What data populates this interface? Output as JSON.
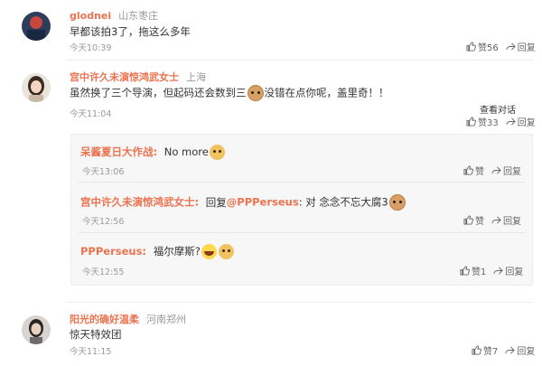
{
  "comments": [
    {
      "name": "glodnei",
      "location": "山东枣庄",
      "text": "早都该拍3了，拖这么多年",
      "time": "今天10:39",
      "like_label": "赞56",
      "reply_label": "回复"
    },
    {
      "name": "宫中许久未演惊鸿武女士",
      "location": "上海",
      "text_a": "虽然换了三个导演，但起码还会数到三",
      "text_b": "没错在点你呢，盖里奇！！",
      "time": "今天11:04",
      "view_conversation": "查看对话",
      "like_label": "赞33",
      "reply_label": "回复"
    },
    {
      "name": "阳光的确好温柔",
      "location": "河南郑州",
      "text": "惊天特效团",
      "time": "今天11:15",
      "like_label": "赞7",
      "reply_label": "回复"
    }
  ],
  "replies": [
    {
      "name": "呆酱夏日大作战:",
      "text": "No more",
      "time": "今天13:06",
      "like_label": "赞",
      "reply_label": "回复"
    },
    {
      "name": "宫中许久未演惊鸿武女士:",
      "prefix": "回复",
      "mention": "@PPPerseus",
      "text": ": 对 念念不忘大腐3",
      "time": "今天12:56",
      "like_label": "赞",
      "reply_label": "回复"
    },
    {
      "name": "PPPerseus:",
      "text": "福尔摩斯?",
      "time": "今天12:55",
      "like_label": "赞1",
      "reply_label": "回复"
    }
  ],
  "colors": {
    "name": "#eb7350",
    "link": "#eb7350",
    "meta": "#999999"
  },
  "icons": {
    "like": "thumbs-up-icon",
    "reply": "share-arrow-icon"
  }
}
